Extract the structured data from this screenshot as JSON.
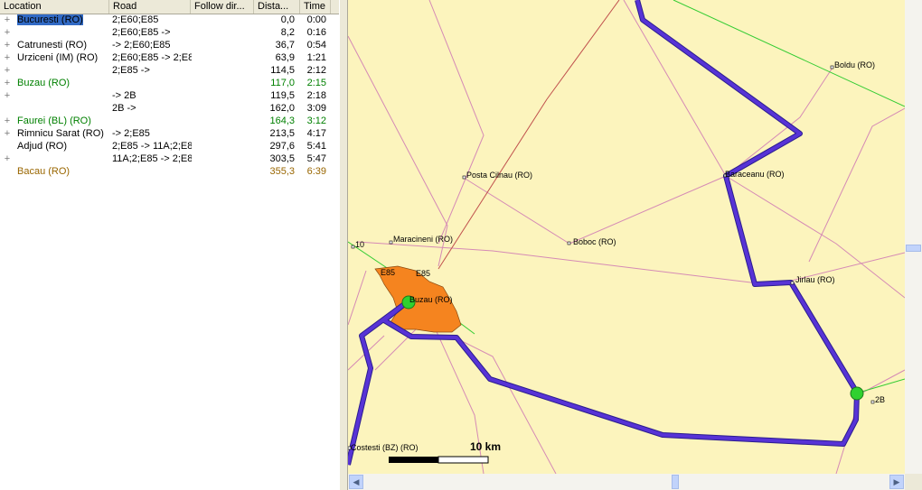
{
  "columns": {
    "location": "Location",
    "road": "Road",
    "follow": "Follow dir...",
    "distance": "Dista...",
    "time": "Time"
  },
  "rows": [
    {
      "expand": "+",
      "location": "Bucuresti (RO)",
      "road": "2;E60;E85",
      "distance": "0,0",
      "time": "0:00",
      "color": "#000000",
      "selected": true
    },
    {
      "expand": "+",
      "location": "",
      "road": "2;E60;E85 ->",
      "distance": "8,2",
      "time": "0:16",
      "color": "#000000"
    },
    {
      "expand": "+",
      "location": "Catrunesti (RO)",
      "road": "-> 2;E60;E85",
      "distance": "36,7",
      "time": "0:54",
      "color": "#000000"
    },
    {
      "expand": "+",
      "location": "Urziceni (IM) (RO)",
      "road": "2;E60;E85 -> 2;E8",
      "distance": "63,9",
      "time": "1:21",
      "color": "#000000"
    },
    {
      "expand": "+",
      "location": "",
      "road": "2;E85 ->",
      "distance": "114,5",
      "time": "2:12",
      "color": "#000000"
    },
    {
      "expand": "+",
      "location": "Buzau (RO)",
      "road": "",
      "distance": "117,0",
      "time": "2:15",
      "color": "#008000"
    },
    {
      "expand": "+",
      "location": "",
      "road": "-> 2B",
      "distance": "119,5",
      "time": "2:18",
      "color": "#000000"
    },
    {
      "expand": "",
      "location": "",
      "road": "2B ->",
      "distance": "162,0",
      "time": "3:09",
      "color": "#000000"
    },
    {
      "expand": "+",
      "location": "Faurei (BL) (RO)",
      "road": "",
      "distance": "164,3",
      "time": "3:12",
      "color": "#008000"
    },
    {
      "expand": "+",
      "location": "Rimnicu Sarat (RO)",
      "road": "-> 2;E85",
      "distance": "213,5",
      "time": "4:17",
      "color": "#000000"
    },
    {
      "expand": "",
      "location": "Adjud (RO)",
      "road": "2;E85 -> 11A;2;E8",
      "distance": "297,6",
      "time": "5:41",
      "color": "#000000"
    },
    {
      "expand": "+",
      "location": "",
      "road": "11A;2;E85 -> 2;E8",
      "distance": "303,5",
      "time": "5:47",
      "color": "#000000"
    },
    {
      "expand": "",
      "location": "Bacau (RO)",
      "road": "",
      "distance": "355,3",
      "time": "6:39",
      "color": "#996600"
    }
  ],
  "map": {
    "labels": {
      "boldu": "Boldu (RO)",
      "posta_cilnau": "Posta Cilnau (RO)",
      "baraceanu": "Baraceanu (RO)",
      "maracineni": "Maracineni (RO)",
      "boboc": "Boboc (RO)",
      "ten": "10",
      "e85a": "E85",
      "e85b": "E85",
      "buzau": "Buzau (RO)",
      "jirlau": "Jirlau (RO)",
      "twob": "2B",
      "costesti": "Costesti (BZ) (RO)"
    },
    "scale_label": "10 km",
    "colors": {
      "background": "#fcf4bd",
      "route": "#5733d6",
      "city": "#f5841f",
      "road_minor": "#d58ab5",
      "road_green": "#33cc33",
      "waypoint": "#2fd12f"
    }
  }
}
